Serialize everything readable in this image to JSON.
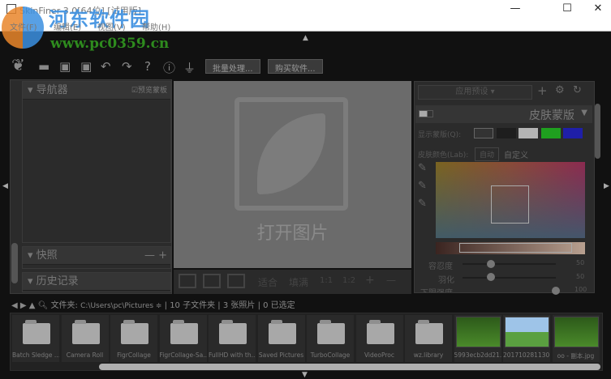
{
  "window": {
    "title": "SkinFiner 3.0[64位] [试用版]",
    "minimize": "—",
    "maximize": "☐",
    "close": "✕"
  },
  "menu": [
    "文件(F)",
    "编辑(E)",
    "视图(V)",
    "帮助(H)"
  ],
  "watermark": {
    "name": "河东软件园",
    "url": "www.pc0359.cn"
  },
  "toolbar": {
    "icons": [
      "leaf-logo-icon",
      "folder-open-icon",
      "save-icon",
      "save-as-icon",
      "undo-icon",
      "redo-icon",
      "help-icon",
      "info-icon",
      "plugin-icon"
    ],
    "batch": "批量处理...",
    "buy": "购买软件..."
  },
  "left": {
    "navigator": "导航器",
    "preview_mask": "预览蒙板",
    "snapshot": "快照",
    "snapshot_controls": "— +",
    "history": "历史记录"
  },
  "center": {
    "open_image": "打开图片",
    "fit": "适合",
    "fill": "填满",
    "z11": "1:1",
    "z12": "1:2",
    "plus": "+",
    "minus": "—"
  },
  "right": {
    "preset": "应用预设",
    "mask_title": "皮肤蒙版",
    "show_mask": "显示蒙版(Q):",
    "skin_color": "皮肤颜色(Lab):",
    "auto": "自动",
    "custom": "自定义",
    "swatches": [
      "#1e1e1e",
      "#b4b4b4",
      "#1fa01f",
      "#1f1fa8"
    ],
    "sliders": [
      {
        "label": "容忍度",
        "value": "50",
        "level": 0.3
      },
      {
        "label": "羽化",
        "value": "50",
        "level": 0.3
      },
      {
        "label": "下限强度",
        "value": "100",
        "level": 1.0
      }
    ]
  },
  "folderbar": {
    "label": "文件夹:",
    "path": "C:\\Users\\pc\\Pictures ≑",
    "subfolders": "| 10 子文件夹",
    "photos": "| 3 张照片",
    "selected": "| 0 已选定"
  },
  "thumbnails": [
    {
      "name": "Batch Sledge ...",
      "type": "folder"
    },
    {
      "name": "Camera Roll",
      "type": "folder"
    },
    {
      "name": "FigrCollage",
      "type": "folder"
    },
    {
      "name": "FigrCollage-Sa...",
      "type": "folder"
    },
    {
      "name": "FullHD with th...",
      "type": "folder"
    },
    {
      "name": "Saved Pictures",
      "type": "folder"
    },
    {
      "name": "TurboCollage",
      "type": "folder"
    },
    {
      "name": "VideoProc",
      "type": "folder"
    },
    {
      "name": "wz.library",
      "type": "folder"
    },
    {
      "name": "5993ecb2dd21...",
      "type": "photo"
    },
    {
      "name": "201710281130...",
      "type": "photo"
    },
    {
      "name": "oo - 副本.jpg",
      "type": "photo"
    }
  ]
}
